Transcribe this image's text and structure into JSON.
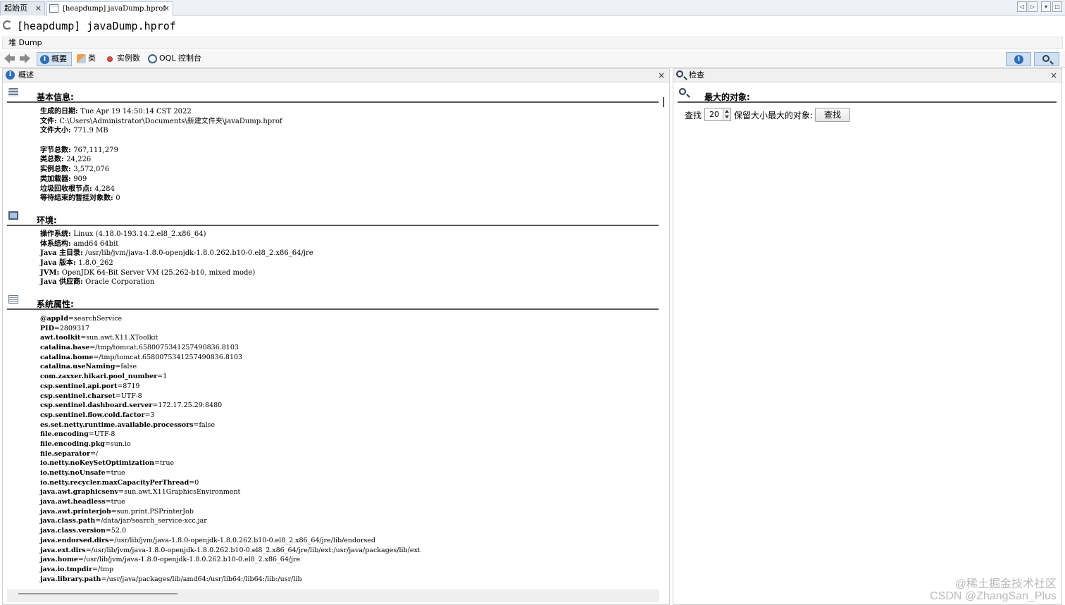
{
  "tabs": [
    {
      "label": "起始页",
      "close": "×"
    },
    {
      "label": "[heapdump] javaDump.hprof",
      "close": "×"
    }
  ],
  "window_controls": [
    "◁",
    "▷",
    "▾",
    "□"
  ],
  "title": "[heapdump] javaDump.hprof",
  "breadcrumb": "堆 Dump",
  "toolbar": {
    "summary": "概要",
    "classes": "类",
    "instances": "实例数",
    "oql": "OQL 控制台"
  },
  "left_panel": {
    "header": "概述",
    "close": "×",
    "sections": {
      "basic": {
        "title": "基本信息:",
        "lines": [
          {
            "key": "生成的日期: ",
            "value": "Tue Apr 19 14:50:14 CST 2022"
          },
          {
            "key": "文件: ",
            "value": "C:\\Users\\Administrator\\Documents\\新建文件夹\\javaDump.hprof"
          },
          {
            "key": "文件大小: ",
            "value": "771.9 MB"
          },
          {
            "key": "",
            "value": ""
          },
          {
            "key": "字节总数: ",
            "value": "767,111,279"
          },
          {
            "key": "类总数: ",
            "value": "24,226"
          },
          {
            "key": "实例总数: ",
            "value": "3,572,076"
          },
          {
            "key": "类加载器: ",
            "value": "909"
          },
          {
            "key": "垃圾回收根节点: ",
            "value": "4,284"
          },
          {
            "key": "等待结束的暂挂对象数: ",
            "value": "0"
          }
        ]
      },
      "env": {
        "title": "环境:",
        "lines": [
          {
            "key": "操作系统: ",
            "value": "Linux (4.18.0-193.14.2.el8_2.x86_64)"
          },
          {
            "key": "体系结构: ",
            "value": "amd64 64bit"
          },
          {
            "key": "Java 主目录: ",
            "value": "/usr/lib/jvm/java-1.8.0-openjdk-1.8.0.262.b10-0.el8_2.x86_64/jre"
          },
          {
            "key": "Java 版本: ",
            "value": "1.8.0_262"
          },
          {
            "key": "JVM: ",
            "value": "OpenJDK 64-Bit Server VM (25.262-b10, mixed mode)"
          },
          {
            "key": "Java 供应商: ",
            "value": "Oracle Corporation"
          }
        ]
      },
      "props": {
        "title": "系统属性:",
        "lines": [
          {
            "key": "@appId",
            "value": "=searchService"
          },
          {
            "key": "PID",
            "value": "=2809317"
          },
          {
            "key": "awt.toolkit",
            "value": "=sun.awt.X11.XToolkit"
          },
          {
            "key": "catalina.base",
            "value": "=/tmp/tomcat.6580075341257490836.8103"
          },
          {
            "key": "catalina.home",
            "value": "=/tmp/tomcat.6580075341257490836.8103"
          },
          {
            "key": "catalina.useNaming",
            "value": "=false"
          },
          {
            "key": "com.zaxxer.hikari.pool_number",
            "value": "=1"
          },
          {
            "key": "csp.sentinel.api.port",
            "value": "=8719"
          },
          {
            "key": "csp.sentinel.charset",
            "value": "=UTF-8"
          },
          {
            "key": "csp.sentinel.dashboard.server",
            "value": "=172.17.25.29:8480"
          },
          {
            "key": "csp.sentinel.flow.cold.factor",
            "value": "=3"
          },
          {
            "key": "es.set.netty.runtime.available.processors",
            "value": "=false"
          },
          {
            "key": "file.encoding",
            "value": "=UTF-8"
          },
          {
            "key": "file.encoding.pkg",
            "value": "=sun.io"
          },
          {
            "key": "file.separator",
            "value": "=/"
          },
          {
            "key": "io.netty.noKeySetOptimization",
            "value": "=true"
          },
          {
            "key": "io.netty.noUnsafe",
            "value": "=true"
          },
          {
            "key": "io.netty.recycler.maxCapacityPerThread",
            "value": "=0"
          },
          {
            "key": "java.awt.graphicsenv",
            "value": "=sun.awt.X11GraphicsEnvironment"
          },
          {
            "key": "java.awt.headless",
            "value": "=true"
          },
          {
            "key": "java.awt.printerjob",
            "value": "=sun.print.PSPrinterJob"
          },
          {
            "key": "java.class.path",
            "value": "=/data/jar/search_service-xcc.jar"
          },
          {
            "key": "java.class.version",
            "value": "=52.0"
          },
          {
            "key": "java.endorsed.dirs",
            "value": "=/usr/lib/jvm/java-1.8.0-openjdk-1.8.0.262.b10-0.el8_2.x86_64/jre/lib/endorsed"
          },
          {
            "key": "java.ext.dirs",
            "value": "=/usr/lib/jvm/java-1.8.0-openjdk-1.8.0.262.b10-0.el8_2.x86_64/jre/lib/ext:/usr/java/packages/lib/ext"
          },
          {
            "key": "java.home",
            "value": "=/usr/lib/jvm/java-1.8.0-openjdk-1.8.0.262.b10-0.el8_2.x86_64/jre"
          },
          {
            "key": "java.io.tmpdir",
            "value": "=/tmp"
          },
          {
            "key": "java.library.path",
            "value": "=/usr/java/packages/lib/amd64:/usr/lib64:/lib64:/lib:/usr/lib"
          }
        ]
      }
    }
  },
  "right_panel": {
    "header": "检查",
    "close": "×",
    "section_title": "最大的对象:",
    "find_label": "查找",
    "count": "20",
    "after_label": "保留大小最大的对象:",
    "find_button": "查找"
  },
  "watermark": {
    "line1": "@稀土掘金技术社区",
    "line2": "CSDN @ZhangSan_Plus"
  }
}
